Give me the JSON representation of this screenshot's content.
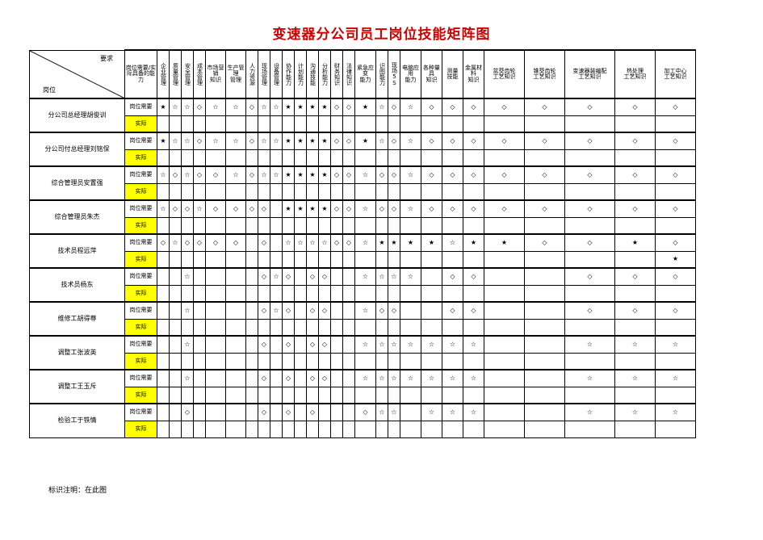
{
  "title": "变速器分公司员工岗位技能矩阵图",
  "corner": {
    "top_label": "要求",
    "bottom_label": "岗位"
  },
  "need_header": "岗位需要/实际具备的能力",
  "row_type_labels": {
    "need": "岗位需要",
    "actual": "实际"
  },
  "footer": "标识注明：在此图",
  "colors": {
    "title": "#d00000",
    "actual_row_highlight": "#ffff00",
    "grid": "#000000"
  },
  "symbols": {
    "star_filled": "★",
    "star_hollow": "☆",
    "diamond": "◇",
    "empty": ""
  },
  "columns": [
    {
      "l1": "企业",
      "l2": "管理",
      "vertical": true,
      "width": 15
    },
    {
      "l1": "质量",
      "l2": "管理",
      "vertical": true,
      "width": 15
    },
    {
      "l1": "安全",
      "l2": "管理",
      "vertical": true,
      "width": 15
    },
    {
      "l1": "成本",
      "l2": "管理",
      "vertical": true,
      "width": 15
    },
    {
      "l1": "市场营销",
      "l2": "知识",
      "vertical": false,
      "width": 25
    },
    {
      "l1": "生产管理",
      "l2": "管理",
      "vertical": false,
      "width": 25
    },
    {
      "l1": "人力",
      "l2": "资源",
      "vertical": true,
      "width": 15
    },
    {
      "l1": "现场",
      "l2": "管理",
      "vertical": true,
      "width": 15
    },
    {
      "l1": "设备",
      "l2": "管理",
      "vertical": true,
      "width": 15
    },
    {
      "l1": "协作",
      "l2": "能力",
      "vertical": true,
      "width": 15
    },
    {
      "l1": "计划",
      "l2": "能力",
      "vertical": true,
      "width": 15
    },
    {
      "l1": "沟通",
      "l2": "技能",
      "vertical": true,
      "width": 15
    },
    {
      "l1": "分析",
      "l2": "能力",
      "vertical": true,
      "width": 15
    },
    {
      "l1": "财务",
      "l2": "知识",
      "vertical": true,
      "width": 15
    },
    {
      "l1": "法律",
      "l2": "知识",
      "vertical": true,
      "width": 15
    },
    {
      "l1": "紧急应变",
      "l2": "能力",
      "vertical": false,
      "width": 26
    },
    {
      "l1": "识图",
      "l2": "能力",
      "vertical": true,
      "width": 15
    },
    {
      "l1": "现场",
      "l2": "5S",
      "vertical": true,
      "width": 15
    },
    {
      "l1": "电脑应用",
      "l2": "能力",
      "vertical": false,
      "width": 26
    },
    {
      "l1": "各种量具",
      "l2": "知识",
      "vertical": false,
      "width": 26
    },
    {
      "l1": "测量",
      "l2": "技能",
      "vertical": false,
      "width": 26
    },
    {
      "l1": "金属材料",
      "l2": "知识",
      "vertical": false,
      "width": 26
    },
    {
      "l1": "盆茭齿轮",
      "l2": "工艺知识",
      "vertical": false,
      "width": 50
    },
    {
      "l1": "锥茭齿轮",
      "l2": "工艺知识",
      "vertical": false,
      "width": 50
    },
    {
      "l1": "变速器装编配",
      "l2": "工艺知识",
      "vertical": false,
      "width": 62
    },
    {
      "l1": "热处理",
      "l2": "工艺知识",
      "vertical": false,
      "width": 50
    },
    {
      "l1": "加工中心",
      "l2": "工艺知识",
      "vertical": false,
      "width": 50
    }
  ],
  "rows": [
    {
      "name": "分公司总经理胡俊训",
      "need": [
        "★",
        "☆",
        "☆",
        "◇",
        "☆",
        "☆",
        "◇",
        "☆",
        "☆",
        "★",
        "★",
        "★",
        "★",
        "◇",
        "◇",
        "★",
        "☆",
        "◇",
        "☆",
        "◇",
        "◇",
        "◇",
        "◇",
        "◇",
        "◇",
        "◇",
        "◇"
      ],
      "actual": [
        "",
        "",
        "",
        "",
        "",
        "",
        "",
        "",
        "",
        "",
        "",
        "",
        "",
        "",
        "",
        "",
        "",
        "",
        "",
        "",
        "",
        "",
        "",
        "",
        "",
        "",
        ""
      ]
    },
    {
      "name": "分公司付总经理刘铭保",
      "need": [
        "★",
        "☆",
        "☆",
        "◇",
        "☆",
        "☆",
        "◇",
        "☆",
        "☆",
        "★",
        "★",
        "★",
        "★",
        "◇",
        "◇",
        "★",
        "☆",
        "◇",
        "☆",
        "◇",
        "◇",
        "◇",
        "◇",
        "◇",
        "◇",
        "◇",
        "◇"
      ],
      "actual": [
        "",
        "",
        "",
        "",
        "",
        "",
        "",
        "",
        "",
        "",
        "",
        "",
        "",
        "",
        "",
        "",
        "",
        "",
        "",
        "",
        "",
        "",
        "",
        "",
        "",
        "",
        ""
      ]
    },
    {
      "name": "综合管理员安置强",
      "need": [
        "☆",
        "◇",
        "☆",
        "◇",
        "◇",
        "☆",
        "◇",
        "☆",
        "☆",
        "★",
        "★",
        "★",
        "★",
        "◇",
        "◇",
        "☆",
        "◇",
        "◇",
        "☆",
        "◇",
        "◇",
        "◇",
        "◇",
        "◇",
        "◇",
        "◇",
        "◇"
      ],
      "actual": [
        "",
        "",
        "",
        "",
        "",
        "",
        "",
        "",
        "",
        "",
        "",
        "",
        "",
        "",
        "",
        "",
        "",
        "",
        "",
        "",
        "",
        "",
        "",
        "",
        "",
        "",
        ""
      ]
    },
    {
      "name": "综合管理员朱杰",
      "need": [
        "☆",
        "◇",
        "◇",
        "☆",
        "◇",
        "◇",
        "◇",
        "◇",
        "",
        "★",
        "★",
        "★",
        "★",
        "◇",
        "◇",
        "☆",
        "◇",
        "◇",
        "☆",
        "◇",
        "◇",
        "◇",
        "◇",
        "◇",
        "◇",
        "◇",
        "◇"
      ],
      "actual": [
        "",
        "",
        "",
        "",
        "",
        "",
        "",
        "",
        "",
        "",
        "",
        "",
        "",
        "",
        "",
        "",
        "",
        "",
        "",
        "",
        "",
        "",
        "",
        "",
        "",
        "",
        ""
      ]
    },
    {
      "name": "技术员程远萍",
      "need": [
        "◇",
        "☆",
        "◇",
        "◇",
        "◇",
        "◇",
        "",
        "◇",
        "",
        "☆",
        "☆",
        "☆",
        "☆",
        "◇",
        "◇",
        "☆",
        "★",
        "★",
        "★",
        "★",
        "☆",
        "★",
        "★",
        "◇",
        "◇",
        "★",
        "◇"
      ],
      "actual": [
        "",
        "",
        "",
        "",
        "",
        "",
        "",
        "",
        "",
        "",
        "",
        "",
        "",
        "",
        "",
        "",
        "",
        "",
        "",
        "",
        "",
        "",
        "",
        "",
        "",
        "",
        "★"
      ]
    },
    {
      "name": "技术员杨东",
      "need": [
        "",
        "",
        "☆",
        "",
        "",
        "",
        "",
        "◇",
        "☆",
        "◇",
        "",
        "◇",
        "◇",
        "",
        "",
        "☆",
        "☆",
        "☆",
        "☆",
        "",
        "◇",
        "◇",
        "",
        "",
        "◇",
        "◇",
        "◇"
      ],
      "actual": [
        "",
        "",
        "",
        "",
        "",
        "",
        "",
        "",
        "",
        "",
        "",
        "",
        "",
        "",
        "",
        "",
        "",
        "",
        "",
        "",
        "",
        "",
        "",
        "",
        "",
        "",
        ""
      ]
    },
    {
      "name": "维修工胡得尊",
      "need": [
        "",
        "",
        "☆",
        "",
        "",
        "",
        "",
        "◇",
        "☆",
        "◇",
        "",
        "◇",
        "◇",
        "",
        "",
        "☆",
        "◇",
        "◇",
        "",
        "",
        "◇",
        "◇",
        "",
        "",
        "◇",
        "◇",
        "◇"
      ],
      "actual": [
        "",
        "",
        "",
        "",
        "",
        "",
        "",
        "",
        "",
        "",
        "",
        "",
        "",
        "",
        "",
        "",
        "",
        "",
        "",
        "",
        "",
        "",
        "",
        "",
        "",
        "",
        ""
      ]
    },
    {
      "name": "调整工张波英",
      "need": [
        "",
        "",
        "☆",
        "",
        "",
        "",
        "",
        "◇",
        "",
        "◇",
        "",
        "◇",
        "◇",
        "",
        "",
        "☆",
        "☆",
        "☆",
        "☆",
        "☆",
        "☆",
        "☆",
        "",
        "",
        "☆",
        "☆",
        "☆"
      ],
      "actual": [
        "",
        "",
        "",
        "",
        "",
        "",
        "",
        "",
        "",
        "",
        "",
        "",
        "",
        "",
        "",
        "",
        "",
        "",
        "",
        "",
        "",
        "",
        "",
        "",
        "",
        "",
        ""
      ]
    },
    {
      "name": "调整工王玉斥",
      "need": [
        "",
        "",
        "☆",
        "",
        "",
        "",
        "",
        "◇",
        "",
        "◇",
        "",
        "◇",
        "◇",
        "",
        "",
        "☆",
        "☆",
        "☆",
        "☆",
        "☆",
        "☆",
        "☆",
        "",
        "",
        "☆",
        "☆",
        "☆"
      ],
      "actual": [
        "",
        "",
        "",
        "",
        "",
        "",
        "",
        "",
        "",
        "",
        "",
        "",
        "",
        "",
        "",
        "",
        "",
        "",
        "",
        "",
        "",
        "",
        "",
        "",
        "",
        "",
        ""
      ]
    },
    {
      "name": "检验工于铁情",
      "need": [
        "",
        "",
        "◇",
        "",
        "",
        "",
        "",
        "◇",
        "",
        "◇",
        "",
        "◇",
        "",
        "",
        "",
        "◇",
        "☆",
        "☆",
        "",
        "☆",
        "☆",
        "☆",
        "",
        "",
        "☆",
        "☆",
        "☆"
      ],
      "actual": [
        "",
        "",
        "",
        "",
        "",
        "",
        "",
        "",
        "",
        "",
        "",
        "",
        "",
        "",
        "",
        "",
        "",
        "",
        "",
        "",
        "",
        "",
        "",
        "",
        "",
        "",
        ""
      ]
    }
  ]
}
